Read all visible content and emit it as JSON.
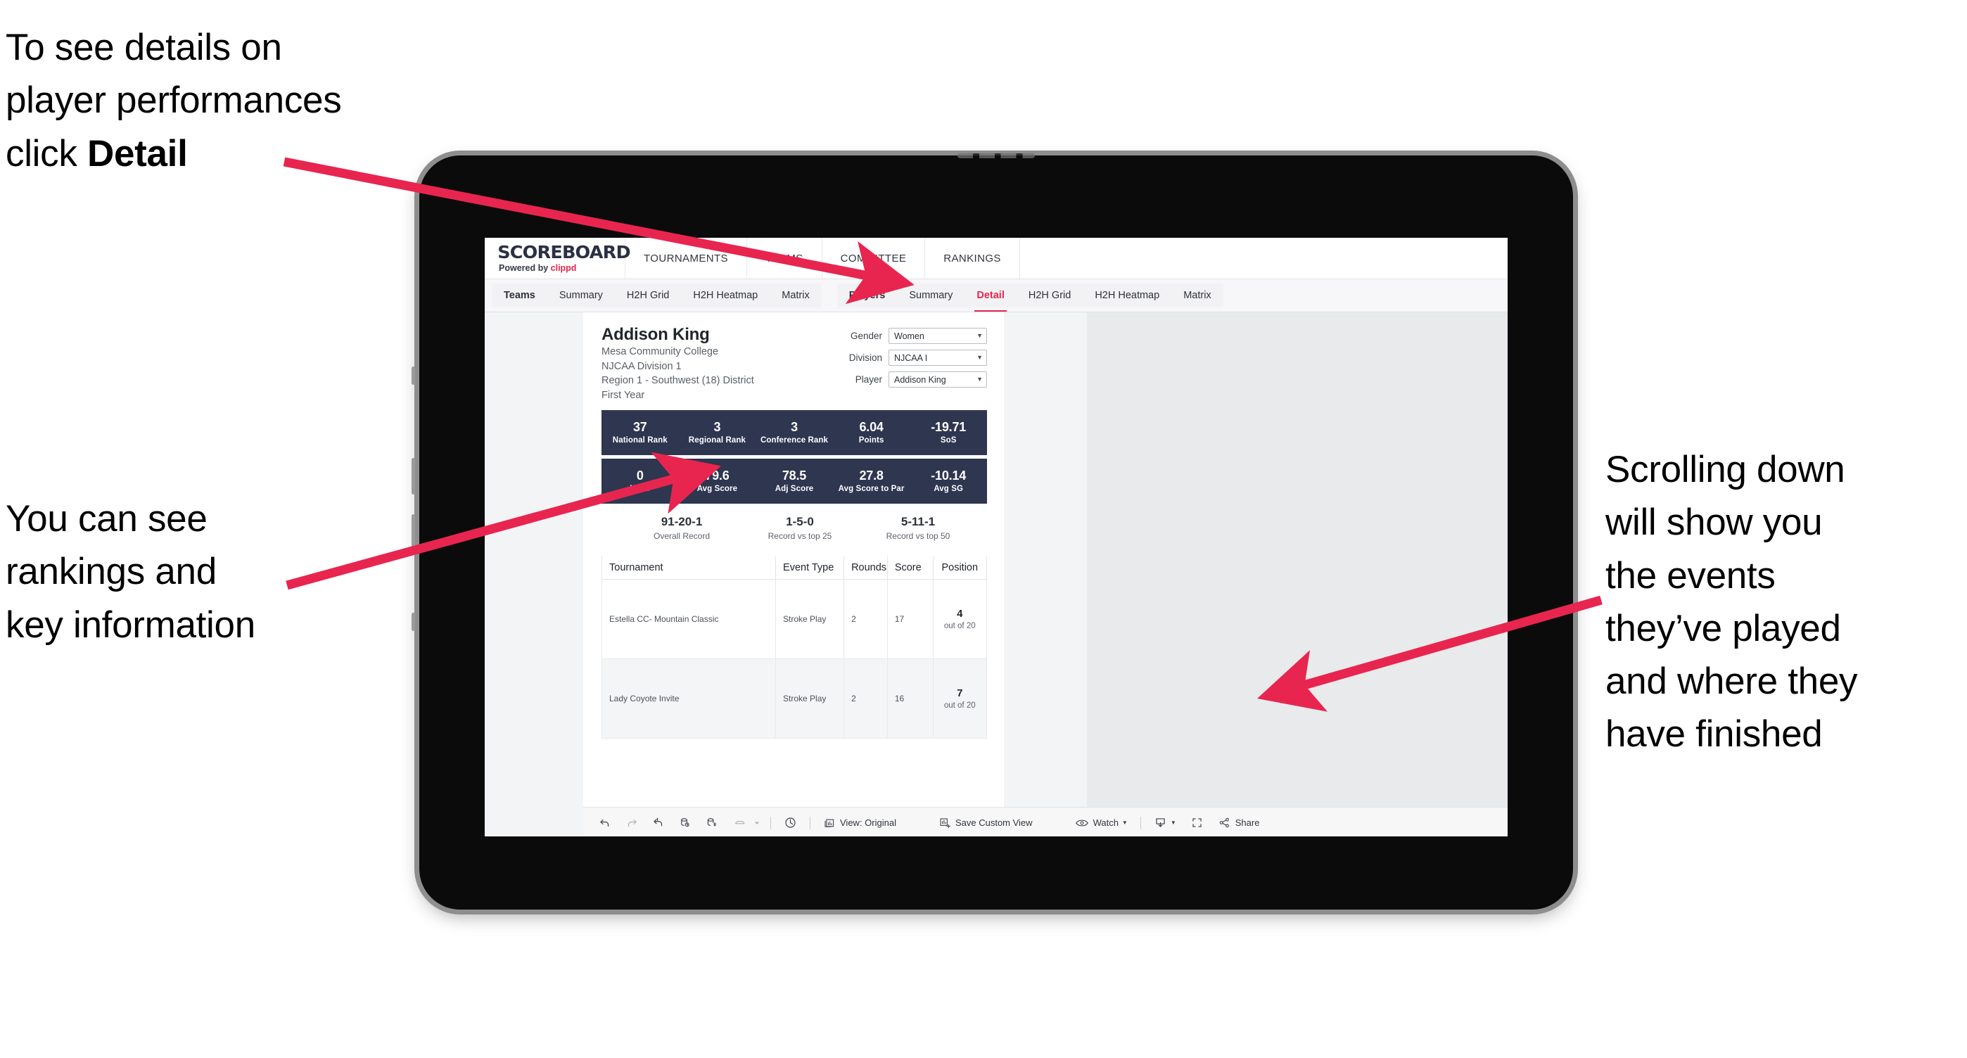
{
  "annotations": {
    "top_left": "To see details on\nplayer performances\nclick ",
    "top_left_bold": "Detail",
    "mid_left": "You can see\nrankings and\nkey information",
    "right": "Scrolling down\nwill show you\nthe events\nthey’ve played\nand where they\nhave finished",
    "arrow_color": "#e8254f"
  },
  "app": {
    "logo": {
      "main": "SCOREBOARD",
      "powered_prefix": "Powered by ",
      "brand": "clippd"
    },
    "top_nav": [
      {
        "label": "TOURNAMENTS"
      },
      {
        "label": "TEAMS"
      },
      {
        "label": "COMMITTEE"
      },
      {
        "label": "RANKINGS"
      }
    ],
    "sub_nav": {
      "group_teams": [
        {
          "label": "Teams",
          "bold": true,
          "active": false
        },
        {
          "label": "Summary",
          "bold": false,
          "active": false
        },
        {
          "label": "H2H Grid",
          "bold": false,
          "active": false
        },
        {
          "label": "H2H Heatmap",
          "bold": false,
          "active": false
        },
        {
          "label": "Matrix",
          "bold": false,
          "active": false
        }
      ],
      "group_players": [
        {
          "label": "Players",
          "bold": true,
          "active": false
        },
        {
          "label": "Summary",
          "bold": false,
          "active": false
        },
        {
          "label": "Detail",
          "bold": false,
          "active": true
        },
        {
          "label": "H2H Grid",
          "bold": false,
          "active": false
        },
        {
          "label": "H2H Heatmap",
          "bold": false,
          "active": false
        },
        {
          "label": "Matrix",
          "bold": false,
          "active": false
        }
      ]
    }
  },
  "player": {
    "name": "Addison King",
    "school": "Mesa Community College",
    "division": "NJCAA Division 1",
    "region": "Region 1 - Southwest (18) District",
    "year": "First Year"
  },
  "filters": [
    {
      "label": "Gender",
      "value": "Women"
    },
    {
      "label": "Division",
      "value": "NJCAA I"
    },
    {
      "label": "Player",
      "value": "Addison King"
    }
  ],
  "stats_row_1": [
    {
      "value": "37",
      "label": "National Rank"
    },
    {
      "value": "3",
      "label": "Regional Rank"
    },
    {
      "value": "3",
      "label": "Conference Rank"
    },
    {
      "value": "6.04",
      "label": "Points"
    },
    {
      "value": "-19.71",
      "label": "SoS"
    }
  ],
  "stats_row_2": [
    {
      "value": "0",
      "label": "Wins"
    },
    {
      "value": "79.6",
      "label": "Avg Score"
    },
    {
      "value": "78.5",
      "label": "Adj Score"
    },
    {
      "value": "27.8",
      "label": "Avg Score to Par"
    },
    {
      "value": "-10.14",
      "label": "Avg SG"
    }
  ],
  "records": [
    {
      "value": "91-20-1",
      "label": "Overall Record"
    },
    {
      "value": "1-5-0",
      "label": "Record vs top 25"
    },
    {
      "value": "5-11-1",
      "label": "Record vs top 50"
    }
  ],
  "table": {
    "columns": [
      "Tournament",
      "Event Type",
      "Rounds",
      "Score",
      "Position"
    ],
    "rows": [
      {
        "tournament": "Estella CC- Mountain Classic",
        "event_type": "Stroke Play",
        "rounds": "2",
        "score": "17",
        "position": "4",
        "position_out_of": "out of 20"
      },
      {
        "tournament": "Lady Coyote Invite",
        "event_type": "Stroke Play",
        "rounds": "2",
        "score": "16",
        "position": "7",
        "position_out_of": "out of 20"
      }
    ]
  },
  "toolbar": {
    "view_label": "View: Original",
    "save_label": "Save Custom View",
    "watch_label": "Watch",
    "share_label": "Share"
  },
  "colors": {
    "accent": "#e8254f",
    "stat_panel": "#2e3650",
    "screen_bg": "#e9eaec"
  }
}
